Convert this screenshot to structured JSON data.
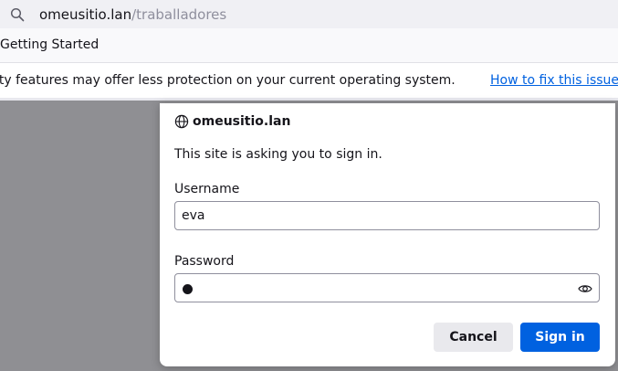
{
  "urlbar": {
    "host": "omeusitio.lan",
    "path": "/traballadores"
  },
  "bookmarks": {
    "items": [
      "Getting Started"
    ]
  },
  "notification": {
    "message": "ity features may offer less protection on your current operating system.",
    "link": "How to fix this issue"
  },
  "dialog": {
    "host": "omeusitio.lan",
    "message": "This site is asking you to sign in.",
    "username_label": "Username",
    "username_value": "eva",
    "password_label": "Password",
    "password_mask": "●",
    "cancel_label": "Cancel",
    "signin_label": "Sign in"
  },
  "colors": {
    "accent": "#0061e0",
    "backdrop": "#8f8f93",
    "toolbar": "#f0f0f4"
  },
  "icons": [
    "search-icon",
    "globe-icon",
    "eye-icon"
  ]
}
